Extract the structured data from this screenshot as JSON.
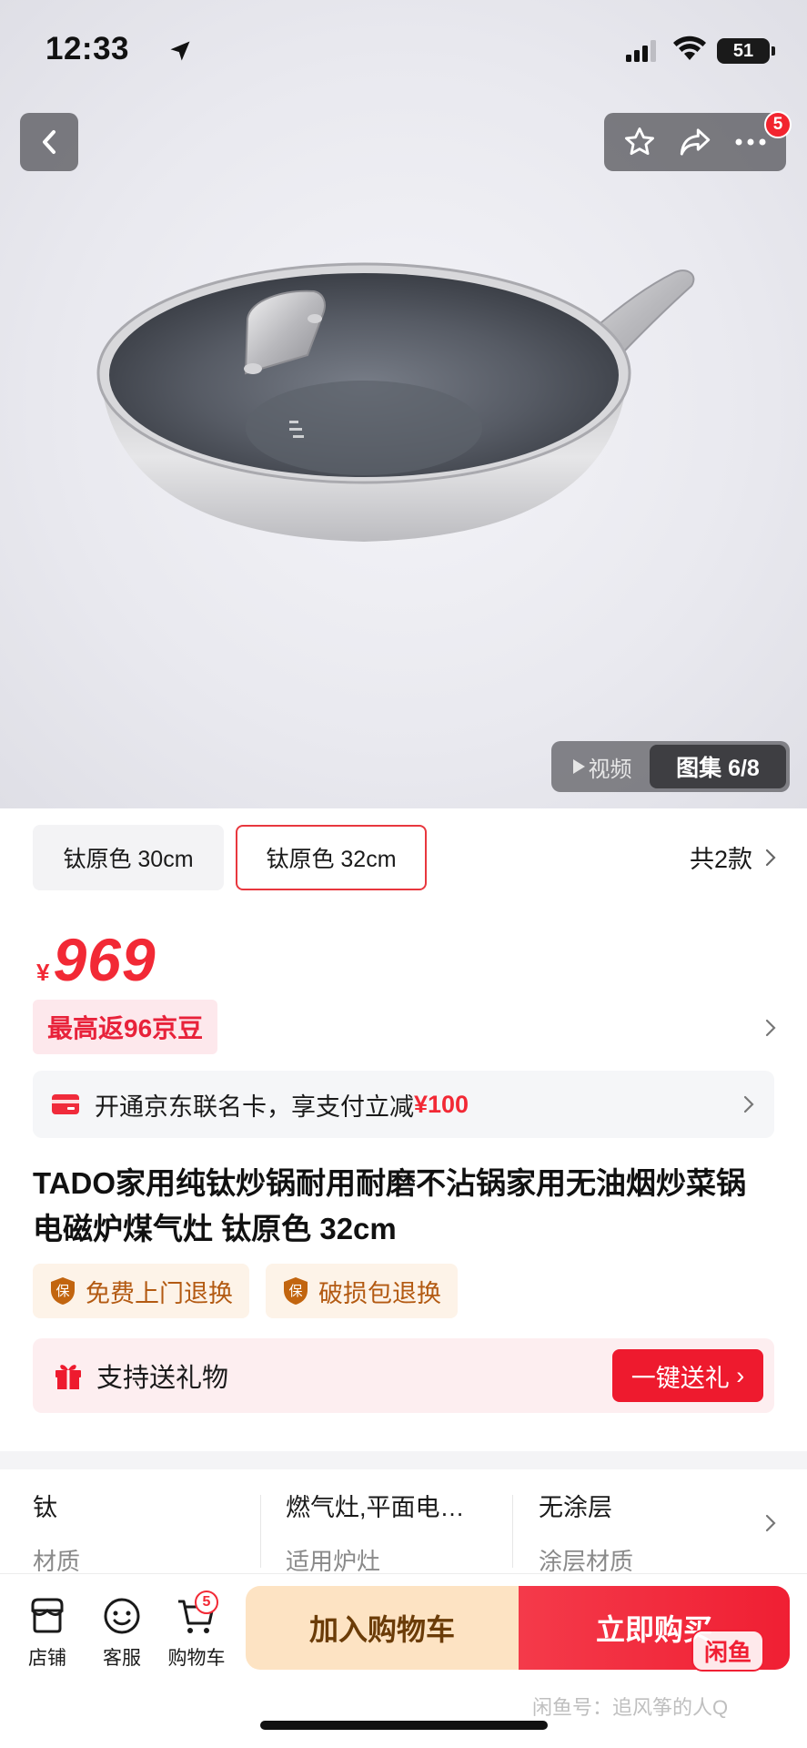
{
  "status_bar": {
    "time": "12:33",
    "battery": "51"
  },
  "hero": {
    "notification_count": "5",
    "media_tabs": {
      "video": "视频",
      "gallery": "图集 6/8"
    }
  },
  "sku": {
    "options": [
      "钛原色 30cm",
      "钛原色 32cm"
    ],
    "selected_index": 1,
    "count_label": "共2款"
  },
  "price": {
    "currency": "¥",
    "value": "969"
  },
  "rebate_tag": "最高返96京豆",
  "card_banner": {
    "text": "开通京东联名卡，享支付立减",
    "amount": "¥100"
  },
  "title": "TADO家用纯钛炒锅耐用耐磨不沾锅家用无油烟炒菜锅电磁炉煤气灶 钛原色 32cm",
  "services": [
    "免费上门退换",
    "破损包退换"
  ],
  "service_icon_char": "保",
  "gift": {
    "label": "支持送礼物",
    "button": "一键送礼"
  },
  "specs": [
    {
      "value": "钛",
      "key": "材质"
    },
    {
      "value": "燃气灶,平面电…",
      "key": "适用炉灶"
    },
    {
      "value": "无涂层",
      "key": "涂层材质"
    }
  ],
  "bottom_nav": {
    "items": [
      "店铺",
      "客服",
      "购物车"
    ],
    "cart_badge": "5",
    "add_to_cart": "加入购物车",
    "buy_now": "立即购买"
  },
  "watermark": {
    "logo": "闲鱼",
    "text": "闲鱼号：追风筝的人Q"
  },
  "colors": {
    "accent_red": "#f22935",
    "service_orange": "#b35a12",
    "add_cart_bg": "#fde3c3"
  }
}
